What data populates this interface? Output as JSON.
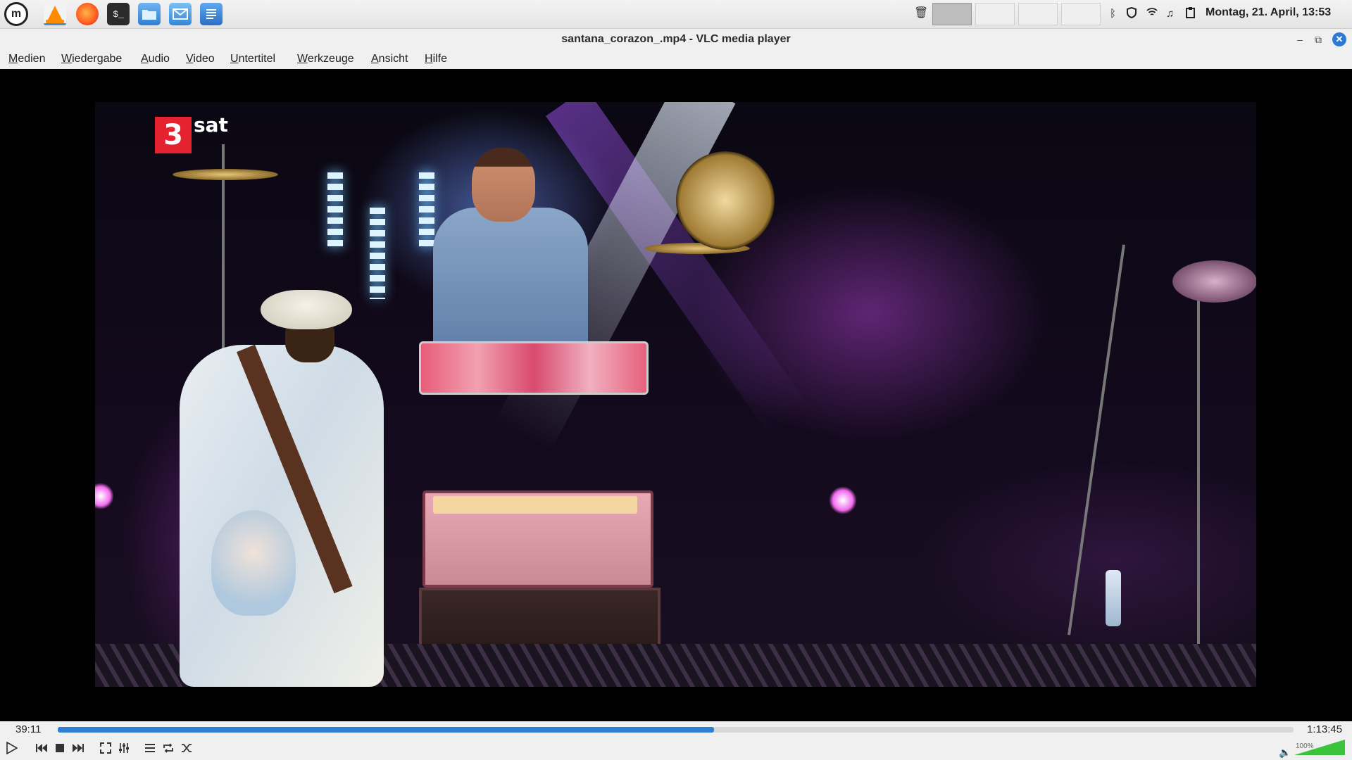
{
  "taskbar": {
    "launchers": [
      "mint-menu",
      "vlc",
      "firefox",
      "terminal",
      "files",
      "mail",
      "writer"
    ],
    "terminal_glyph": "$_",
    "clock": "Montag, 21. April, 13:53",
    "workspaces": 4,
    "active_workspace": 1
  },
  "window": {
    "title": "santana_corazon_.mp4 - VLC media player",
    "min_glyph": "–",
    "max_glyph": "⧉",
    "close_glyph": "✕"
  },
  "menu": [
    {
      "label": "Medien",
      "u": "M",
      "rest": "edien"
    },
    {
      "label": "Wiedergabe",
      "u": "W",
      "rest": "iedergabe"
    },
    {
      "label": "Audio",
      "u": "A",
      "rest": "udio"
    },
    {
      "label": "Video",
      "u": "V",
      "rest": "ideo"
    },
    {
      "label": "Untertitel",
      "u": "U",
      "rest": "ntertitel"
    },
    {
      "label": "Werkzeuge",
      "u": "W",
      "rest": "erkzeuge"
    },
    {
      "label": "Ansicht",
      "u": "A",
      "rest": "nsicht"
    },
    {
      "label": "Hilfe",
      "u": "H",
      "rest": "ilfe"
    }
  ],
  "video": {
    "channel_logo_number": "3",
    "channel_logo_text": "sat"
  },
  "playback": {
    "elapsed": "39:11",
    "total": "1:13:45",
    "progress": 0.531
  },
  "volume": {
    "label": "100%",
    "level": 1.0
  },
  "colors": {
    "accent": "#2f7fd3",
    "logo_red": "#e5222f",
    "volume_green": "#3cc33c"
  }
}
